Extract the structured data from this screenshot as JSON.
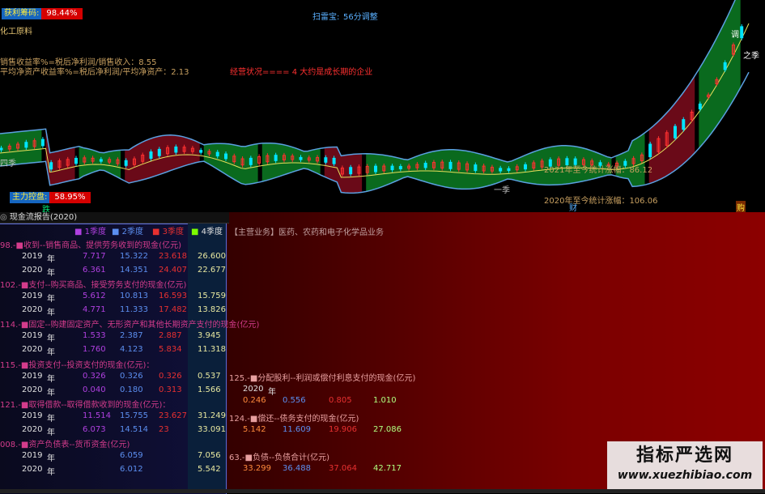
{
  "top": {
    "profit_chips_label": "获利筹码:",
    "profit_chips_value": "98.44%",
    "sector": "化工原料",
    "indicator_name": "扫雷宝:",
    "indicator_period": "56分调整",
    "sales_margin": "销售收益率%=税后净利润/销售收入：8.55",
    "roe": "平均净资产收益率%=税后净利润/平均净资产：2.13",
    "business_status": "经营状况==== 4 大约是成长期的企业",
    "main_control_label": "主力控盘:",
    "main_control_value": "58.95%",
    "label_die": "跌",
    "label_zhi_ji_right": "之季",
    "label_ji_left": "四季",
    "label_yi_ji": "一季",
    "label_tiao": "调",
    "stat_2021": "2021年至今统计涨幅：86.12",
    "stat_2020": "2020年至今统计涨幅：106.06",
    "label_cai": "财",
    "label_gou": "购"
  },
  "panel": {
    "title": "现金流报告(2020)",
    "quarter_headers": [
      "1季度",
      "2季度",
      "3季度",
      "4季度"
    ],
    "main_business": "【主营业务】医药、农药和电子化学品业务",
    "sections_left": [
      {
        "title": "98.-■收到--销售商品、提供劳务收到的现金(亿元)",
        "rows": [
          {
            "year": "2019",
            "unit": "年",
            "q1": "7.717",
            "q2": "15.322",
            "q3": "23.618",
            "q4": "26.600"
          },
          {
            "year": "2020",
            "unit": "年",
            "q1": "6.361",
            "q2": "14.351",
            "q3": "24.407",
            "q4": "22.677"
          }
        ]
      },
      {
        "title": "102.-■支付--购买商品、接受劳务支付的现金(亿元)",
        "rows": [
          {
            "year": "2019",
            "unit": "年",
            "q1": "5.612",
            "q2": "10.813",
            "q3": "16.593",
            "q4": "15.759"
          },
          {
            "year": "2020",
            "unit": "年",
            "q1": "4.771",
            "q2": "11.333",
            "q3": "17.482",
            "q4": "13.826"
          }
        ]
      },
      {
        "title": "114.-■固定--购建固定资产、无形资产和其他长期资产支付的现金(亿元)",
        "rows": [
          {
            "year": "2019",
            "unit": "年",
            "q1": "1.533",
            "q2": "2.387",
            "q3": "2.887",
            "q4": "3.945"
          },
          {
            "year": "2020",
            "unit": "年",
            "q1": "1.760",
            "q2": "4.123",
            "q3": "5.834",
            "q4": "11.318"
          }
        ]
      },
      {
        "title": "115.-■投资支付--投资支付的现金(亿元)：",
        "rows": [
          {
            "year": "2019",
            "unit": "年",
            "q1": "0.326",
            "q2": "0.326",
            "q3": "0.326",
            "q4": "0.537"
          },
          {
            "year": "2020",
            "unit": "年",
            "q1": "0.040",
            "q2": "0.180",
            "q3": "0.313",
            "q4": "1.566"
          }
        ]
      },
      {
        "title": "121.-■取得借款--取得借款收到的现金(亿元)：",
        "rows": [
          {
            "year": "2019",
            "unit": "年",
            "q1": "11.514",
            "q2": "15.755",
            "q3": "23.627",
            "q4": "31.249"
          },
          {
            "year": "2020",
            "unit": "年",
            "q1": "6.073",
            "q2": "14.514",
            "q3": "23",
            "q4": "33.091"
          }
        ]
      },
      {
        "title": "008.-■资产负债表--货币资金(亿元)",
        "rows": [
          {
            "year": "2019",
            "unit": "年",
            "q1": "",
            "q2": "6.059",
            "q3": "",
            "q4": "7.056"
          },
          {
            "year": "2020",
            "unit": "年",
            "q1": "",
            "q2": "6.012",
            "q3": "",
            "q4": "5.542"
          }
        ]
      }
    ],
    "sections_right": [
      {
        "title": "125.-■分配股利--利润或偿付利息支付的现金(亿元)",
        "year": "2020",
        "unit": "年",
        "q1": "0.246",
        "q2": "0.556",
        "q3": "0.805",
        "q4": "1.010"
      },
      {
        "title": "124.-■偿还--债务支付的现金(亿元)",
        "q1": "5.142",
        "q2": "11.609",
        "q3": "19.906",
        "q4": "27.086"
      },
      {
        "title": "63.-■负债--负债合计(亿元)",
        "q1": "33.299",
        "q2": "36.488",
        "q3": "37.064",
        "q4": "42.717"
      }
    ]
  },
  "watermark": {
    "cn": "指标严选网",
    "url": "www.xuezhibiao.com"
  },
  "colors": {
    "candle_up": "#ff3030",
    "candle_down": "#00e5ff",
    "band_green": "#0a6a1e",
    "band_red": "#6a0a18",
    "band_line": "#5aa0e0",
    "mid_line": "#e6e05a"
  }
}
